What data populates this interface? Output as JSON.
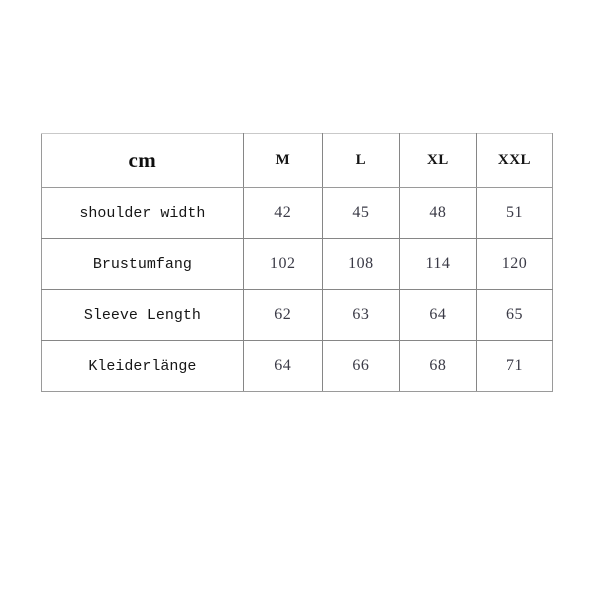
{
  "table": {
    "unit_label": "cm",
    "size_columns": [
      "M",
      "L",
      "XL",
      "XXL"
    ],
    "rows": [
      {
        "label": "shoulder width",
        "values": [
          "42",
          "45",
          "48",
          "51"
        ]
      },
      {
        "label": "Brustumfang",
        "values": [
          "102",
          "108",
          "114",
          "120"
        ]
      },
      {
        "label": "Sleeve Length",
        "values": [
          "62",
          "63",
          "64",
          "65"
        ]
      },
      {
        "label": "Kleiderlänge",
        "values": [
          "64",
          "66",
          "68",
          "71"
        ]
      }
    ]
  },
  "colors": {
    "page_background": "#ffffff",
    "grid_line": "#868686",
    "outer_edge": "#9a9a9a",
    "top_edge": "#c9c9c9",
    "label_text": "#161616",
    "value_text": "#3a3a46",
    "header_text": "#141414"
  }
}
